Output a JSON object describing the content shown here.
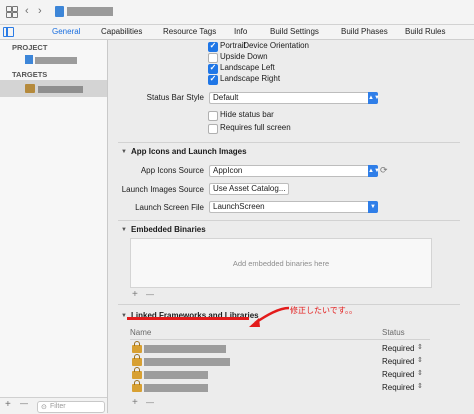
{
  "toolbar": {
    "grid_icon": "grid-icon",
    "back_glyph": "‹",
    "forward_glyph": "›"
  },
  "tabs": [
    {
      "label": "General",
      "active": true
    },
    {
      "label": "Capabilities"
    },
    {
      "label": "Resource Tags"
    },
    {
      "label": "Info"
    },
    {
      "label": "Build Settings"
    },
    {
      "label": "Build Phases"
    },
    {
      "label": "Build Rules"
    }
  ],
  "navigator": {
    "project_header": "PROJECT",
    "targets_header": "TARGETS",
    "add_glyph": "+",
    "filter_glyph": "⊙",
    "filter_placeholder": "Filter"
  },
  "deployment": {
    "orientation_label": "Device Orientation",
    "orientations": [
      {
        "label": "Portrait",
        "checked": true
      },
      {
        "label": "Upside Down",
        "checked": false
      },
      {
        "label": "Landscape Left",
        "checked": true
      },
      {
        "label": "Landscape Right",
        "checked": true
      }
    ],
    "status_bar_label": "Status Bar Style",
    "status_bar_value": "Default",
    "hide_status_bar": "Hide status bar",
    "requires_full_screen": "Requires full screen"
  },
  "app_icons": {
    "title": "App Icons and Launch Images",
    "icons_source_label": "App Icons Source",
    "icons_source_value": "AppIcon",
    "launch_images_label": "Launch Images Source",
    "launch_images_button": "Use Asset Catalog...",
    "launch_screen_label": "Launch Screen File",
    "launch_screen_value": "LaunchScreen"
  },
  "embedded": {
    "title": "Embedded Binaries",
    "placeholder": "Add embedded binaries here",
    "add_glyph": "+",
    "remove_glyph": "—"
  },
  "linked": {
    "title": "Linked Frameworks and Libraries",
    "annotation": "修正したいです。。",
    "col_name": "Name",
    "col_status": "Status",
    "rows": [
      {
        "status": "Required"
      },
      {
        "status": "Required"
      },
      {
        "status": "Required"
      },
      {
        "status": "Required"
      }
    ],
    "add_glyph": "+",
    "remove_glyph": "—",
    "stepper_glyph": "⇕"
  },
  "colors": {
    "accent": "#1f76e6",
    "annotation_red": "#e31b1b"
  }
}
